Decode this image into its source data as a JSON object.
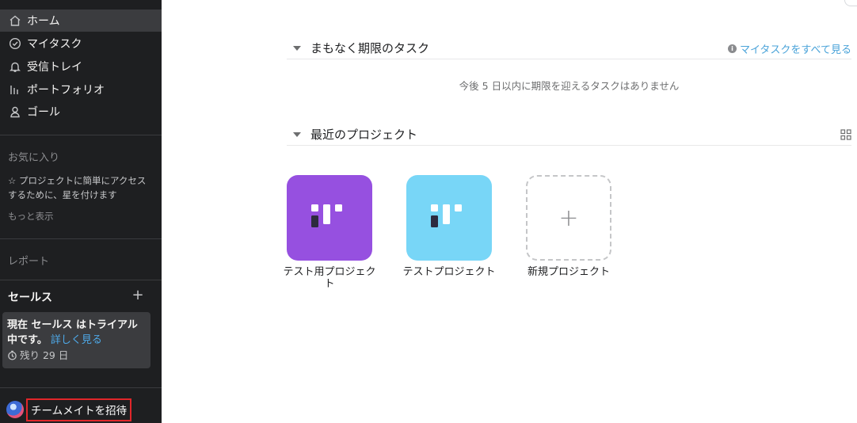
{
  "sidebar": {
    "nav": [
      {
        "label": "ホーム",
        "icon": "home-icon"
      },
      {
        "label": "マイタスク",
        "icon": "check-circle-icon"
      },
      {
        "label": "受信トレイ",
        "icon": "bell-icon"
      },
      {
        "label": "ポートフォリオ",
        "icon": "bar-chart-icon"
      },
      {
        "label": "ゴール",
        "icon": "person-icon"
      }
    ],
    "favorites": {
      "title": "お気に入り",
      "hint": "☆ プロジェクトに簡単にアクセスするために、星を付けます",
      "more": "もっと表示"
    },
    "reports_title": "レポート",
    "team": {
      "name": "セールス",
      "add": "+",
      "trial_prefix": "現在 セールス はトライアル中です。",
      "trial_link": "詳しく見る",
      "days_left": "残り 29 日"
    },
    "invite_label": "チームメイトを招待"
  },
  "main": {
    "due_section": {
      "title": "まもなく期限のタスク",
      "see_all": "マイタスクをすべて見る",
      "empty_message": "今後 5 日以内に期限を迎えるタスクはありません"
    },
    "recent_section": {
      "title": "最近のプロジェクト"
    },
    "projects": [
      {
        "name": "テスト用プロジェクト",
        "color": "#9650e0"
      },
      {
        "name": "テストプロジェクト",
        "color": "#78d6f7"
      }
    ],
    "new_project_label": "新規プロジェクト",
    "new_project_symbol": "+"
  },
  "colors": {
    "sidebar_bg": "#1e1f21",
    "link": "#4aa3d9",
    "highlight_border": "#e0262a"
  }
}
